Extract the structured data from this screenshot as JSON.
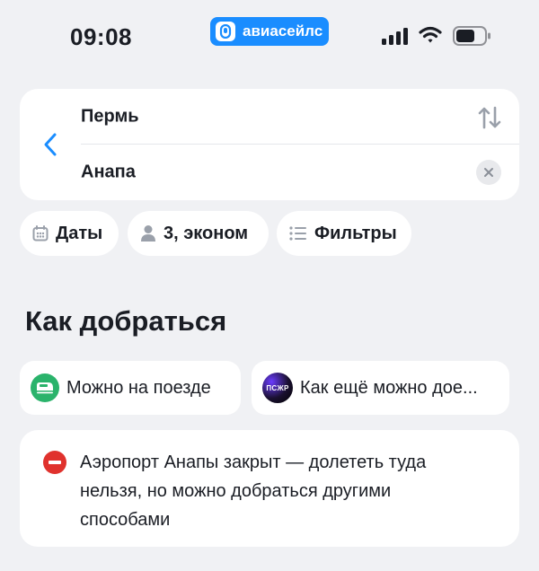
{
  "status_bar": {
    "time": "09:08",
    "app_name": "авиасейлс"
  },
  "search": {
    "from": "Пермь",
    "to": "Анапа",
    "icons": {
      "back": "chevron-left-icon",
      "swap": "swap-arrows-icon",
      "clear": "close-icon"
    }
  },
  "chips": {
    "dates": "Даты",
    "passengers": "3, эконом",
    "filters": "Фильтры"
  },
  "section": {
    "title": "Как добраться"
  },
  "options": {
    "train": "Можно на поезде",
    "other": "Как ещё можно дое...",
    "other_logo_text": "ПСЖР"
  },
  "notice": {
    "text": "Аэропорт Анапы закрыт — долететь туда нельзя, но можно добраться другими способами"
  },
  "colors": {
    "accent": "#1a8dff",
    "train_green": "#2ab36b",
    "alert_red": "#e0322d",
    "background": "#f0f1f4"
  }
}
